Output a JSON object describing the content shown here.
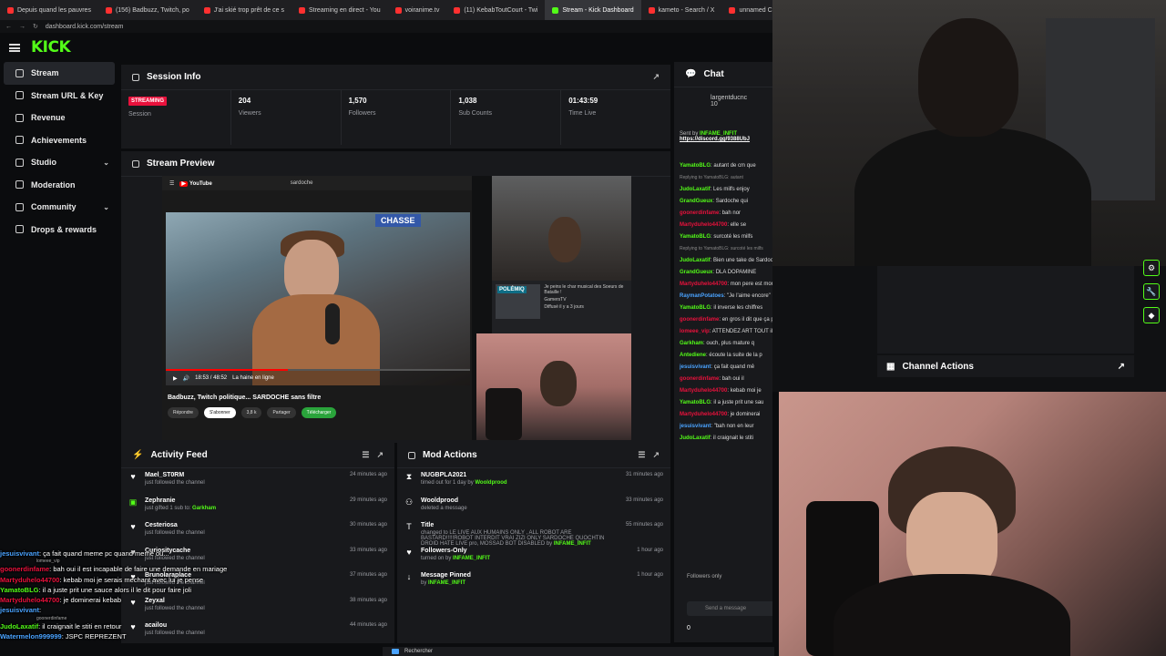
{
  "browser": {
    "tabs": [
      {
        "label": "Depuis quand les pauvres"
      },
      {
        "label": "(156) Badbuzz, Twitch, po"
      },
      {
        "label": "J'ai skié trop prêt de ce s"
      },
      {
        "label": "Streaming en direct - You"
      },
      {
        "label": "voiranime.tv"
      },
      {
        "label": "(11) KebabToutCourt - Twi"
      },
      {
        "label": "Stream - Kick Dashboard",
        "active": true
      },
      {
        "label": "kameto - Search / X"
      },
      {
        "label": "unnamed C"
      }
    ],
    "url": "dashboard.kick.com/stream"
  },
  "header": {
    "logo": "KICK"
  },
  "sidebar": {
    "items": [
      {
        "label": "Stream",
        "icon": "broadcast-icon",
        "active": true
      },
      {
        "label": "Stream URL & Key",
        "icon": "link-icon"
      },
      {
        "label": "Revenue",
        "icon": "revenue-icon"
      },
      {
        "label": "Achievements",
        "icon": "trophy-icon"
      },
      {
        "label": "Studio",
        "icon": "studio-icon",
        "expandable": true
      },
      {
        "label": "Moderation",
        "icon": "gavel-icon"
      },
      {
        "label": "Community",
        "icon": "community-icon",
        "expandable": true
      },
      {
        "label": "Drops & rewards",
        "icon": "gift-icon"
      }
    ]
  },
  "session_info": {
    "title": "Session Info",
    "status_badge": "STREAMING",
    "session_label": "Session",
    "viewers": "204",
    "viewers_label": "Viewers",
    "followers": "1,570",
    "followers_label": "Followers",
    "sub_counts": "1,038",
    "sub_counts_label": "Sub Counts",
    "time_live": "01:43:59",
    "time_live_label": "Time Live"
  },
  "stream_preview": {
    "title": "Stream Preview",
    "yt_logo": "YouTube",
    "yt_search": "sardoche",
    "chasse_text": "CHASSE",
    "yt_time": "18:53 / 48:52",
    "yt_subtitle": "La haine en ligne",
    "video_title": "Badbuzz, Twitch politique... SARDOCHE sans filtre",
    "likes": "3,8 k",
    "subscribe": "S'abonner",
    "share": "Partager",
    "download": "Télécharger",
    "reply": "Répondre",
    "side_video_badge": "POLÉMIQ",
    "side_video_title": "Je peins le char musical des Soeurs de Bataille !",
    "side_video_channel": "GamersTV",
    "side_video_meta": "Diffusé il y a 3 jours"
  },
  "activity_feed": {
    "title": "Activity Feed",
    "items": [
      {
        "name": "Mael_ST0RM",
        "detail": "just followed the channel",
        "time": "24 minutes ago",
        "icon": "heart-icon"
      },
      {
        "name": "Zephranie",
        "detail_prefix": "just gifted 1 sub to:",
        "detail_user": "Garkham",
        "time": "29 minutes ago",
        "icon": "gift-icon"
      },
      {
        "name": "Cesteriosa",
        "detail": "just followed the channel",
        "time": "30 minutes ago",
        "icon": "heart-icon"
      },
      {
        "name": "Curiositycache",
        "detail": "just followed the channel",
        "time": "33 minutes ago",
        "icon": "heart-icon"
      },
      {
        "name": "Brunolaraplace",
        "detail": "just followed the channel",
        "time": "37 minutes ago",
        "icon": "heart-icon"
      },
      {
        "name": "Zeyxal",
        "detail": "just followed the channel",
        "time": "38 minutes ago",
        "icon": "heart-icon"
      },
      {
        "name": "acailou",
        "detail": "just followed the channel",
        "time": "44 minutes ago",
        "icon": "heart-icon"
      }
    ]
  },
  "mod_actions": {
    "title": "Mod Actions",
    "items": [
      {
        "name": "NUGBPLA2021",
        "detail_prefix": "timed out for 1 day by",
        "detail_user": "Wooldprood",
        "time": "31 minutes ago",
        "icon": "hourglass-icon"
      },
      {
        "name": "Wooldprood",
        "detail": "deleted a message",
        "time": "33 minutes ago",
        "icon": "users-icon"
      },
      {
        "name": "Title",
        "detail_prefix": "changed to LE LIVE AUX HUMAINS ONLY , ALL ROBOT ARE BASTARD!!!!!ROBOT INTERDIT VRAI ZIZI ONLY SARDOCHE QUOCHTIN DROID HATE LIVE pro, MOSSAD BOT DISABLED by",
        "detail_user": "INFAME_INFIT",
        "time": "55 minutes ago",
        "icon": "title-icon"
      },
      {
        "name": "Followers-Only",
        "detail_prefix": "turned on by",
        "detail_user": "INFAME_INFIT",
        "time": "1 hour ago",
        "icon": "heart-icon"
      },
      {
        "name": "Message Pinned",
        "detail_prefix": "by",
        "detail_user": "INFAME_INFIT",
        "time": "1 hour ago",
        "icon": "pin-icon"
      }
    ]
  },
  "chat": {
    "title": "Chat",
    "top_user": "largentducnc",
    "top_count": "10",
    "pinned_sender_label": "Sent by",
    "pinned_sender": "INFAME_INFIT",
    "pinned_link": "https://discord.gg/9388UbJ",
    "messages": [
      {
        "user": "YamatoBLG",
        "text": "autant de cm que",
        "color": "#53fc18"
      },
      {
        "reply": "Replying to YamatoBLG: autant"
      },
      {
        "user": "JudoLaxatif",
        "text": "Les milfs enjoy",
        "color": "#53fc18"
      },
      {
        "user": "GrandGueux",
        "text": "Sardoche qui",
        "color": "#53fc18"
      },
      {
        "user": "goonerdinfame",
        "text": "bah nor",
        "color": "#e9113c"
      },
      {
        "user": "Martyduhelo44700",
        "text": "elle se",
        "color": "#e9113c"
      },
      {
        "user": "YamatoBLG",
        "text": "surcoté les milfs",
        "color": "#53fc18"
      },
      {
        "reply": "Replying to YamatoBLG: surcoté les milfs"
      },
      {
        "user": "JudoLaxatif",
        "text": "Bien une take de Sardoche ça",
        "color": "#53fc18"
      },
      {
        "user": "GrandGueux",
        "text": "DLA DOPAMINE",
        "color": "#53fc18"
      },
      {
        "user": "Martyduhelo44700",
        "text": "mon pere est mort",
        "color": "#e9113c"
      },
      {
        "user": "RaymanPotatoes",
        "text": "\"Je l'aime encore\" LIE",
        "color": "#4aa3ff"
      },
      {
        "user": "YamatoBLG",
        "text": "il inverse les chiffres",
        "color": "#53fc18"
      },
      {
        "user": "goonerdinfame",
        "text": "en gros il dit que ça passe prck il l'a",
        "color": "#e9113c"
      },
      {
        "user": "lomeee_vip",
        "text": "ATTENDEZ ART TOUT il est plus avec roro",
        "color": "#e9113c"
      },
      {
        "user": "Garkham",
        "text": "ouch, plus mature q",
        "color": "#53fc18"
      },
      {
        "user": "Antediene",
        "text": "écoute la suite de la p",
        "color": "#53fc18"
      },
      {
        "user": "jesuisvivant",
        "text": "ça fait quand mê",
        "color": "#4aa3ff"
      },
      {
        "user": "goonerdinfame",
        "text": "bah oui il",
        "color": "#e9113c"
      },
      {
        "user": "Martyduhelo44700",
        "text": "kebab moi je",
        "color": "#e9113c"
      },
      {
        "user": "YamatoBLG",
        "text": "il a juste prit une sau",
        "color": "#53fc18"
      },
      {
        "user": "Martyduhelo44700",
        "text": "je dominerai",
        "color": "#e9113c"
      },
      {
        "user": "jesuisvivant",
        "text": "\"bah non en leur",
        "color": "#4aa3ff"
      },
      {
        "user": "JudoLaxatif",
        "text": "il craignait le stiti",
        "color": "#53fc18"
      }
    ],
    "followers_only_label": "Followers only",
    "input_placeholder": "Send a message",
    "viewer_count_small": "0"
  },
  "channel_actions": {
    "title": "Channel Actions"
  },
  "chat_overlay": [
    {
      "user": "jesuisvivant",
      "text": "ça fait quand meme pc quand meme ou...",
      "color": "#4aa3ff"
    },
    {
      "reply": "lomeee_vip"
    },
    {
      "user": "goonerdinfame",
      "text": "bah oui il est incapable de faire une demande en mariage",
      "color": "#e9113c"
    },
    {
      "user": "Martyduhelo44700",
      "text": "kebab moi je serais mechant avec lui je pense",
      "color": "#e9113c"
    },
    {
      "user": "YamatoBLG",
      "text": "il a juste prit une sauce alors il le dit pour faire joli",
      "color": "#53fc18"
    },
    {
      "user": "Martyduhelo44700",
      "text": "je dominerai kebab",
      "color": "#e9113c"
    },
    {
      "user": "jesuisvivant",
      "text": "",
      "color": "#4aa3ff"
    },
    {
      "reply": "goonerdinfame"
    },
    {
      "user": "JudoLaxatif",
      "text": "il craignait le stiti en retour",
      "color": "#53fc18"
    },
    {
      "user": "Watermelon999999",
      "text": "JSPC REPREZENT",
      "color": "#4aa3ff"
    }
  ],
  "taskbar": {
    "search": "Rechercher"
  }
}
